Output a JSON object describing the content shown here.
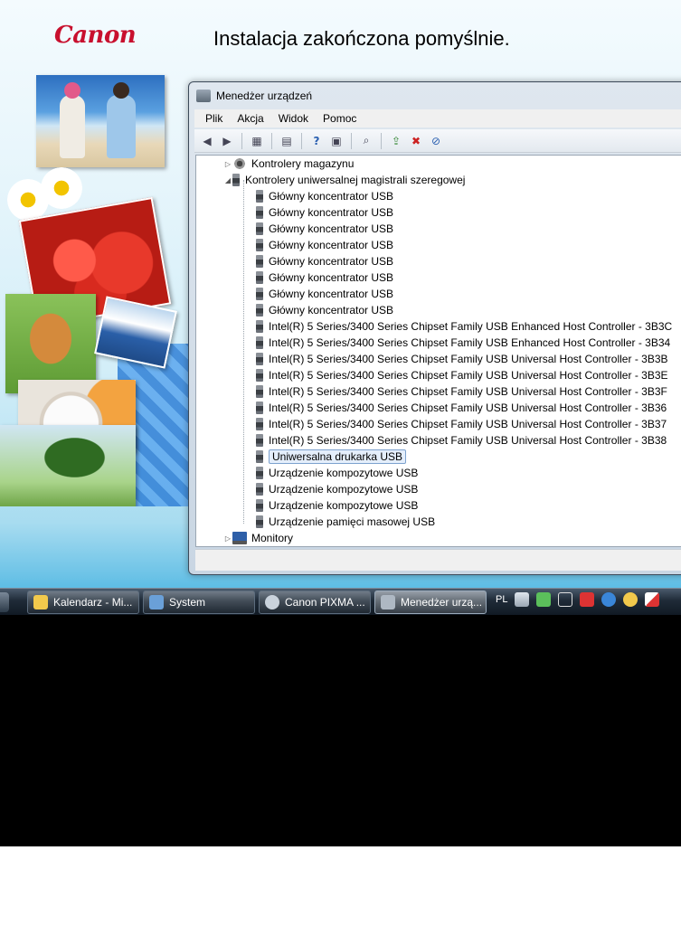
{
  "installer": {
    "logo_text": "Canon",
    "title": "Instalacja zakończona pomyślnie."
  },
  "window": {
    "title": "Menedżer urządzeń",
    "menu": [
      "Plik",
      "Akcja",
      "Widok",
      "Pomoc"
    ],
    "toolbar_icons": [
      "back-arrow-icon",
      "forward-arrow-icon",
      "console-tree-icon",
      "properties-icon",
      "help-icon",
      "view-icon",
      "scan-hardware-icon",
      "update-driver-icon",
      "uninstall-device-icon",
      "disable-device-icon"
    ]
  },
  "tree": {
    "storage_controllers": "Kontrolery magazynu",
    "usb_controllers": "Kontrolery uniwersalnej magistrali szeregowej",
    "usb_devices": [
      "Główny koncentrator USB",
      "Główny koncentrator USB",
      "Główny koncentrator USB",
      "Główny koncentrator USB",
      "Główny koncentrator USB",
      "Główny koncentrator USB",
      "Główny koncentrator USB",
      "Główny koncentrator USB",
      "Intel(R) 5 Series/3400 Series Chipset Family USB Enhanced Host Controller - 3B3C",
      "Intel(R) 5 Series/3400 Series Chipset Family USB Enhanced Host Controller - 3B34",
      "Intel(R) 5 Series/3400 Series Chipset Family USB Universal Host Controller - 3B3B",
      "Intel(R) 5 Series/3400 Series Chipset Family USB Universal Host Controller - 3B3E",
      "Intel(R) 5 Series/3400 Series Chipset Family USB Universal Host Controller - 3B3F",
      "Intel(R) 5 Series/3400 Series Chipset Family USB Universal Host Controller - 3B36",
      "Intel(R) 5 Series/3400 Series Chipset Family USB Universal Host Controller - 3B37",
      "Intel(R) 5 Series/3400 Series Chipset Family USB Universal Host Controller - 3B38",
      "Uniwersalna drukarka USB",
      "Urządzenie kompozytowe USB",
      "Urządzenie kompozytowe USB",
      "Urządzenie kompozytowe USB",
      "Urządzenie pamięci masowej USB"
    ],
    "selected": "Uniwersalna drukarka USB",
    "monitors": "Monitory"
  },
  "taskbar": {
    "buttons": [
      {
        "label": "Kalendarz - Mi...",
        "icon": "calendar-icon",
        "color": "#f2c94c"
      },
      {
        "label": "System",
        "icon": "system-icon",
        "color": "#6aa0d8"
      },
      {
        "label": "Canon PIXMA ...",
        "icon": "canon-installer-icon",
        "color": "#c9d2dc"
      },
      {
        "label": "Menedżer urzą...",
        "icon": "device-manager-icon",
        "color": "#aeb8c3"
      }
    ],
    "language": "PL"
  }
}
